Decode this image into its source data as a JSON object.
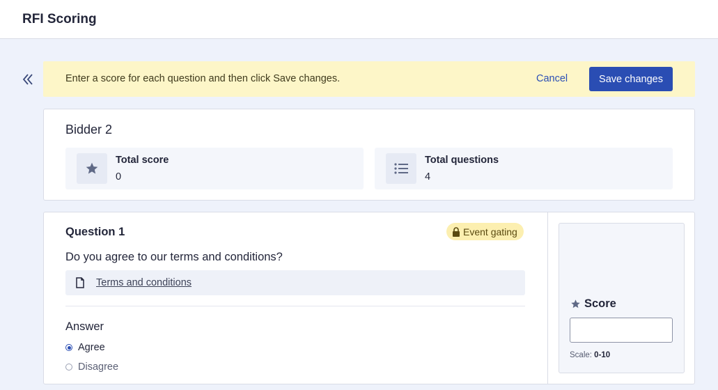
{
  "header": {
    "title": "RFI Scoring"
  },
  "banner": {
    "message": "Enter a score for each question and then click Save changes.",
    "cancel_label": "Cancel",
    "save_label": "Save changes"
  },
  "bidder": {
    "name": "Bidder 2",
    "stats": [
      {
        "icon": "star-icon",
        "label": "Total score",
        "value": "0"
      },
      {
        "icon": "list-icon",
        "label": "Total questions",
        "value": "4"
      }
    ]
  },
  "question": {
    "title": "Question 1",
    "badge": "Event gating",
    "text": "Do you agree to our terms and conditions?",
    "attachment": "Terms and conditions",
    "answer_title": "Answer",
    "options": [
      {
        "label": "Agree",
        "selected": true
      },
      {
        "label": "Disagree",
        "selected": false
      }
    ]
  },
  "score": {
    "title": "Score",
    "value": "",
    "scale_label": "Scale:",
    "scale_range": "0-10"
  },
  "colors": {
    "primary": "#2a4db3",
    "banner_bg": "#fdf6c8",
    "badge_bg": "#fcefb0",
    "page_bg": "#eef2fb"
  }
}
